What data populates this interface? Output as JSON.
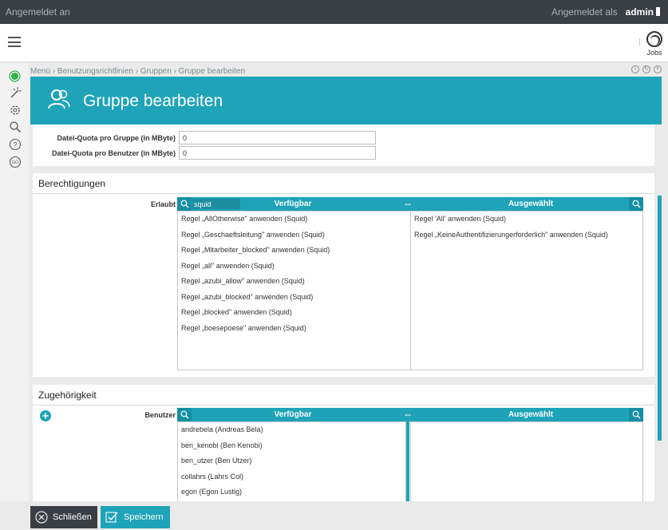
{
  "topbar": {
    "login_status": "Angemeldet an",
    "logged_as_label": "Angemeldet als",
    "username": "admin"
  },
  "navbar": {
    "jobs_label": "Jobs"
  },
  "breadcrumb": "Menü › Benutzungsrichtlinien › Gruppen › Gruppe bearbeiten",
  "window_controls": [
    "i",
    "↻",
    "×"
  ],
  "header": {
    "title": "Gruppe bearbeiten"
  },
  "quota": {
    "group_label": "Datei-Quota pro Gruppe (in MByte)",
    "group_value": "0",
    "user_label": "Datei-Quota pro Benutzer (in MByte)",
    "user_value": "0"
  },
  "permissions": {
    "title": "Berechtigungen",
    "field_label": "Erlaubt",
    "search_value": "squid",
    "available_header": "Verfügbar",
    "selected_header": "Ausgewählt",
    "available_items": [
      "Regel „AllOtherwise\" anwenden (Squid)",
      "Regel „Geschaeftsleitung\" anwenden (Squid)",
      "Regel „Mitarbeiter_blocked\" anwenden (Squid)",
      "Regel „all\" anwenden (Squid)",
      "Regel „azubi_allow\" anwenden (Squid)",
      "Regel „azubi_blocked\" anwenden (Squid)",
      "Regel „blocked\" anwenden (Squid)",
      "Regel „boesepoese\" anwenden (Squid)"
    ],
    "selected_items": [
      "Regel 'All' anwenden (Squid)",
      "Regel „KeineAuthentifizierungerforderlich\" anwenden (Squid)"
    ]
  },
  "membership": {
    "title": "Zugehörigkeit",
    "field_label": "Benutzer",
    "available_header": "Verfügbar",
    "selected_header": "Ausgewählt",
    "available_items": [
      "andrebela (Andreas Bela)",
      "ben_kenobi (Ben Kenobi)",
      "ben_utzer (Ben Utzer)",
      "collahrs (Lahrs Col)",
      "egon (Egon Lustig)"
    ],
    "selected_items": []
  },
  "footer": {
    "close_label": "Schließen",
    "save_label": "Speichern"
  },
  "colors": {
    "accent": "#1fa3b8",
    "topbar": "#3a3f45",
    "status_green": "#2fb34a"
  },
  "icons": {
    "status": "status-dot-icon",
    "wizard": "magic-wand-icon",
    "settings": "gear-icon",
    "search": "magnifier-icon",
    "help": "question-icon",
    "go": "go-icon",
    "add": "plus-circle-icon"
  }
}
